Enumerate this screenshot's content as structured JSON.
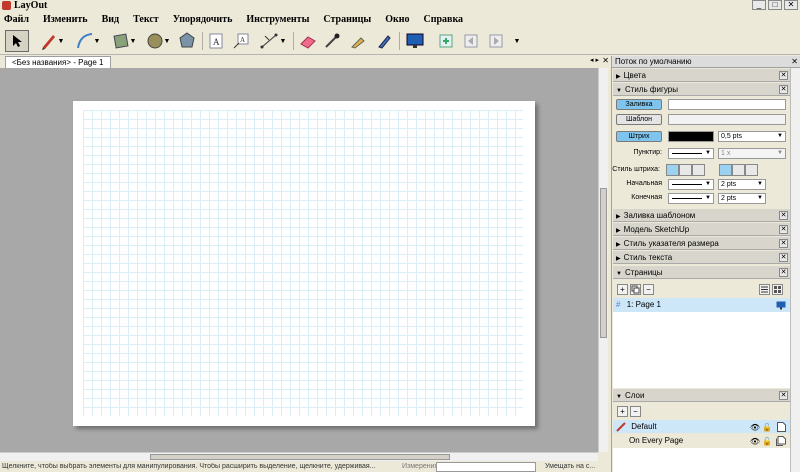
{
  "app": {
    "title": "LayOut"
  },
  "window_buttons": {
    "minimize": "_",
    "maximize": "□",
    "close": "✕"
  },
  "menu": [
    "Файл",
    "Изменить",
    "Вид",
    "Текст",
    "Упорядочить",
    "Инструменты",
    "Страницы",
    "Окно",
    "Справка"
  ],
  "toolbar_icons": [
    "select-arrow-icon",
    "pencil-icon",
    "arc-icon",
    "rectangle-icon",
    "circle-icon",
    "polygon-icon",
    "text-icon",
    "label-icon",
    "dimension-icon",
    "eraser-icon",
    "eyedropper-icon",
    "paint-bucket-icon",
    "split-icon",
    "presentation-icon",
    "add-page-icon",
    "previous-page-icon",
    "next-page-icon"
  ],
  "document": {
    "tab_label": "<Без названия> - Page 1",
    "tab_arrows": "◂ ▸",
    "tab_close": "✕"
  },
  "status": {
    "text": "Щелкните, чтобы выбрать элементы для манипулирования. Чтобы расширить выделение, щелкните, удерживая...",
    "measure_label": "Измерения",
    "zoom_label": "Умещать на с..."
  },
  "tray": {
    "title": "Поток по умолчанию",
    "sections": {
      "colors": "Цвета",
      "shape_style": "Стиль фигуры",
      "pattern_fill": "Заливка шаблоном",
      "sketchup_model": "Модель SketchUp",
      "dimension_style": "Стиль указателя размера",
      "text_style": "Стиль текста",
      "pages": "Страницы",
      "layers": "Слои"
    },
    "shape_style": {
      "fill_button": "Заливка",
      "pattern_button": "Шаблон",
      "stroke_button": "Штрих",
      "stroke_width": "0,5 pts",
      "dash_label": "Пунктир:",
      "dash_scale": "1 x",
      "stroke_style_label": "Стиль штриха:",
      "start_label": "Начальная",
      "start_size": "2 pts",
      "end_label": "Конечная",
      "end_size": "2 pts",
      "stroke_color": "#000000"
    },
    "pages": {
      "items": [
        {
          "number": "1:",
          "name": "Page 1"
        }
      ],
      "add": "+",
      "remove": "−"
    },
    "layers": {
      "items": [
        "Default",
        "On Every Page"
      ],
      "add": "+",
      "remove": "−"
    }
  },
  "colors": {
    "accent": "#7ec4ec",
    "selection": "#cde6f8",
    "grid": "#d9eef5",
    "canvas_bg": "#a8a8a8"
  }
}
